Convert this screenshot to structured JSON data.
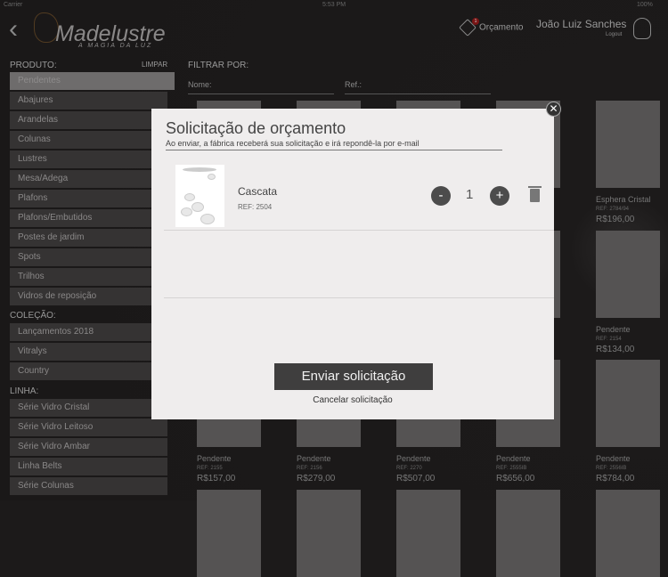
{
  "status": {
    "carrier": "Carrier",
    "time": "5:53 PM",
    "battery": "100%"
  },
  "header": {
    "logo": "Madelustre",
    "tagline": "A MAGIA DA LUZ",
    "quote_label": "Orçamento",
    "quote_count": "1",
    "user_name": "João Luiz Sanches",
    "logout": "Logout"
  },
  "sidebar": {
    "produto_label": "PRODUTO:",
    "limpar": "LIMPAR",
    "produto": [
      "Pendentes",
      "Abajures",
      "Arandelas",
      "Colunas",
      "Lustres",
      "Mesa/Adega",
      "Plafons",
      "Plafons/Embutidos",
      "Postes de jardim",
      "Spots",
      "Trilhos",
      "Vidros de reposição"
    ],
    "colecao_label": "COLEÇÃO:",
    "colecao": [
      "Lançamentos 2018",
      "Vitralys",
      "Country"
    ],
    "linha_label": "LINHA:",
    "linha": [
      "Série Vidro Cristal",
      "Série Vidro Leitoso",
      "Série Vidro Ambar",
      "Linha Belts",
      "Série Colunas"
    ]
  },
  "filter": {
    "label": "FILTRAR POR:",
    "name_label": "Nome:",
    "ref_label": "Ref.:"
  },
  "products": [
    {
      "name": "Esphera Cristal",
      "ref": "REF: 2784/94",
      "price": "R$196,00"
    },
    {
      "name": "Pendente",
      "ref": "REF: 2154",
      "price": "R$134,00"
    },
    {
      "name": "Pendente",
      "ref": "REF: 2155",
      "price": "R$157,00"
    },
    {
      "name": "Pendente",
      "ref": "REF: 2156",
      "price": "R$279,00"
    },
    {
      "name": "Pendente",
      "ref": "REF: 2270",
      "price": "R$507,00"
    },
    {
      "name": "Pendente",
      "ref": "REF: 2555IB",
      "price": "R$656,00"
    },
    {
      "name": "Pendente",
      "ref": "REF: 2556IB",
      "price": "R$784,00"
    }
  ],
  "modal": {
    "title": "Solicitação de orçamento",
    "subtitle": "Ao enviar, a fábrica receberá sua solicitação e irá repondê-la por e-mail",
    "item": {
      "name": "Cascata",
      "ref": "REF: 2504",
      "qty": "1",
      "minus": "-",
      "plus": "+"
    },
    "send": "Enviar solicitação",
    "cancel": "Cancelar solicitação",
    "close": "✕"
  }
}
